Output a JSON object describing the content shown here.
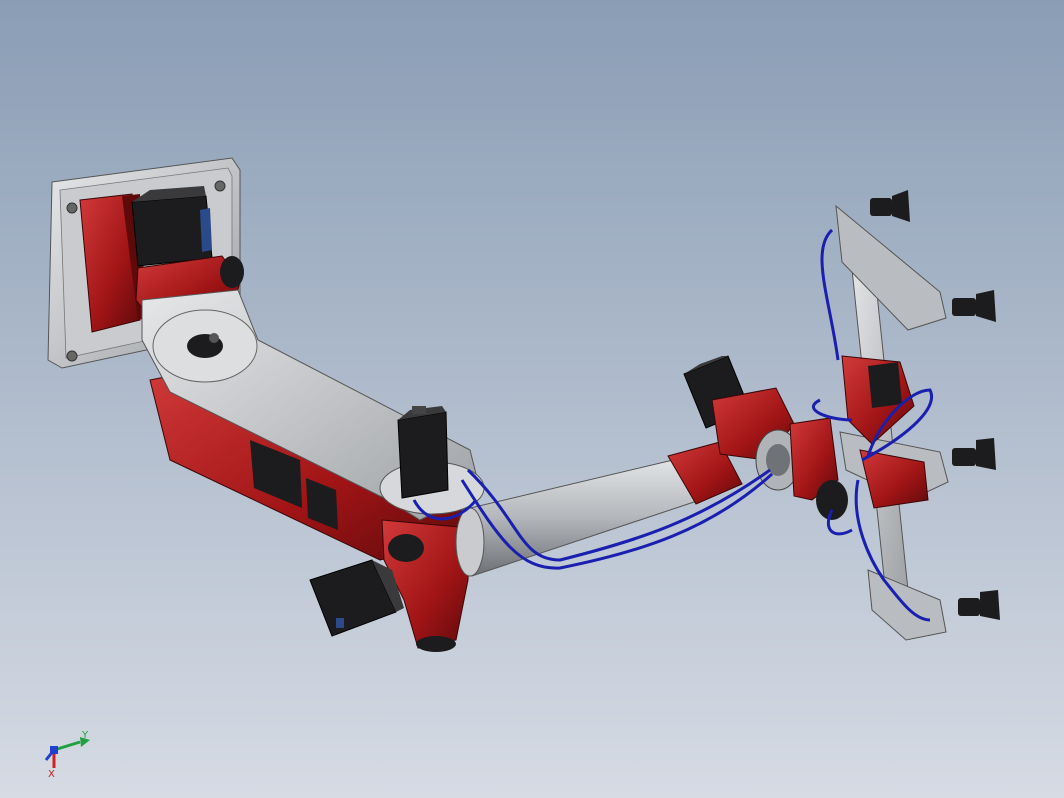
{
  "viewport": {
    "background_top": "#8a9db5",
    "background_bottom": "#d6dbe4"
  },
  "colors": {
    "red": "#a01416",
    "red_dark": "#5e0a0b",
    "red_light": "#d23a3a",
    "steel": "#b9bcc0",
    "steel_light": "#dadcdf",
    "steel_dark": "#6f7377",
    "motor_black": "#1c1c1e",
    "hose_blue": "#1a1fb0",
    "axis_x": "#d02020",
    "axis_y": "#20a040",
    "axis_z": "#2040d0"
  },
  "triad": {
    "x_label": "X",
    "y_label": "Y",
    "x_icon": "axis-x-arrow",
    "y_icon": "axis-y-arrow",
    "z_icon": "axis-z-arrow"
  }
}
